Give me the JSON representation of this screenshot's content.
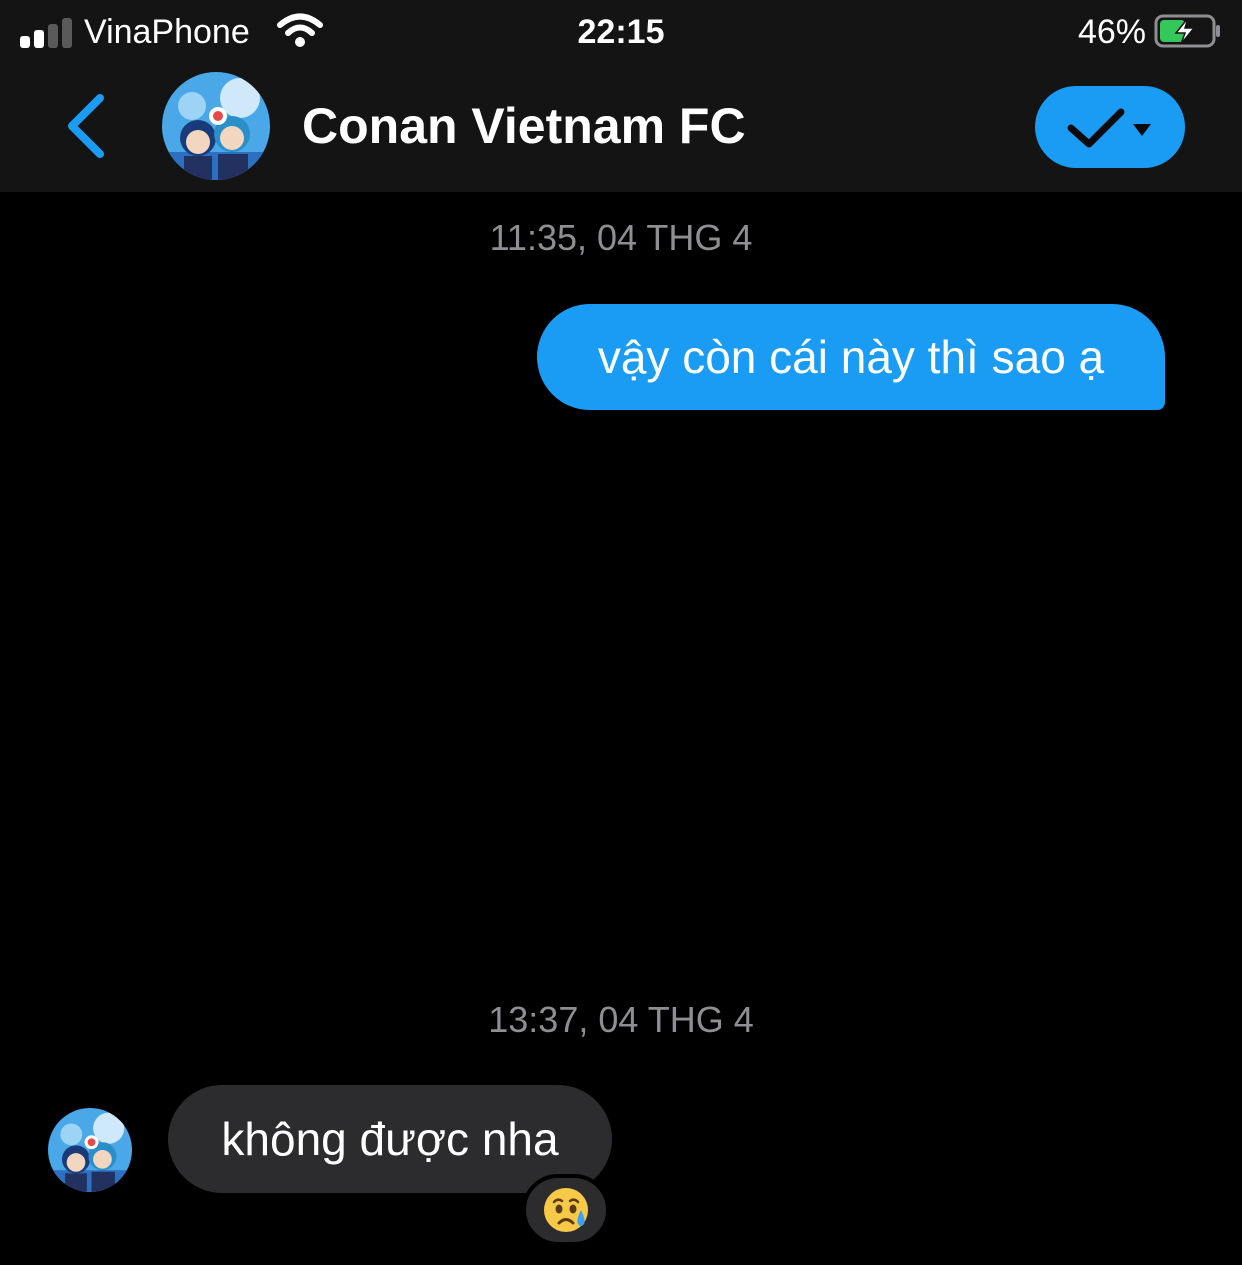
{
  "status_bar": {
    "carrier": "VinaPhone",
    "time": "22:15",
    "battery_percent": "46%",
    "battery_level": 0.46,
    "signal_bars": 2,
    "signal_bars_total": 4
  },
  "header": {
    "back_icon": "chevron-left-icon",
    "contact_name": "Conan Vietnam FC",
    "status_icon": "checkmark-dropdown-icon"
  },
  "messages": [
    {
      "type": "timestamp",
      "text": "11:35, 04 THG 4"
    },
    {
      "type": "outgoing",
      "text": "vậy còn cái này thì sao ạ"
    },
    {
      "type": "timestamp",
      "text": "13:37, 04 THG 4"
    },
    {
      "type": "incoming",
      "text": "không được nha",
      "reaction": "😥"
    }
  ],
  "colors": {
    "accent": "#1a9cf5",
    "background": "#000000",
    "header_bg": "#141414",
    "incoming_bubble": "#2c2c2e",
    "timestamp": "#8e8e93",
    "battery_charging": "#34c759"
  }
}
